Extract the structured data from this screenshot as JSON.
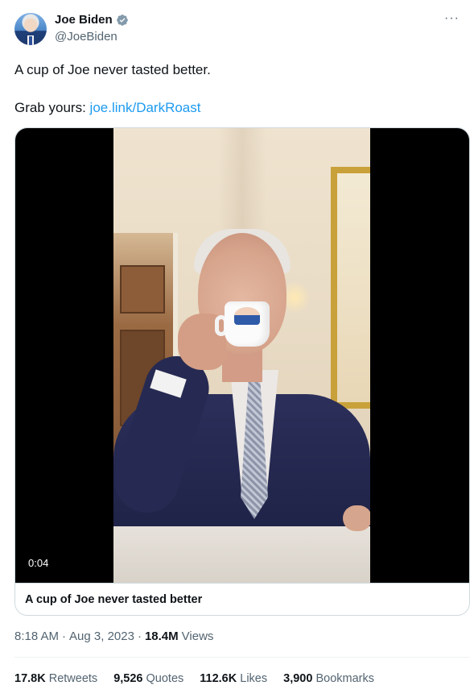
{
  "author": {
    "display_name": "Joe Biden",
    "handle": "@JoeBiden",
    "verified_badge_color": "#829aab"
  },
  "more_menu_label": "···",
  "tweet": {
    "line1": "A cup of Joe never tasted better.",
    "line2_prefix": "Grab yours: ",
    "link_text": "joe.link/DarkRoast",
    "link_color": "#1d9bf0"
  },
  "video": {
    "duration_label": "0:04",
    "caption": "A cup of Joe never tasted better"
  },
  "meta": {
    "time": "8:18 AM",
    "separator1": "·",
    "date": "Aug 3, 2023",
    "separator2": "·",
    "views_count": "18.4M",
    "views_label": "Views"
  },
  "stats": [
    {
      "count": "17.8K",
      "label": "Retweets"
    },
    {
      "count": "9,526",
      "label": "Quotes"
    },
    {
      "count": "112.6K",
      "label": "Likes"
    },
    {
      "count": "3,900",
      "label": "Bookmarks"
    }
  ],
  "icons": {
    "verified": "verified-badge-icon",
    "more": "more-horizontal-icon"
  }
}
